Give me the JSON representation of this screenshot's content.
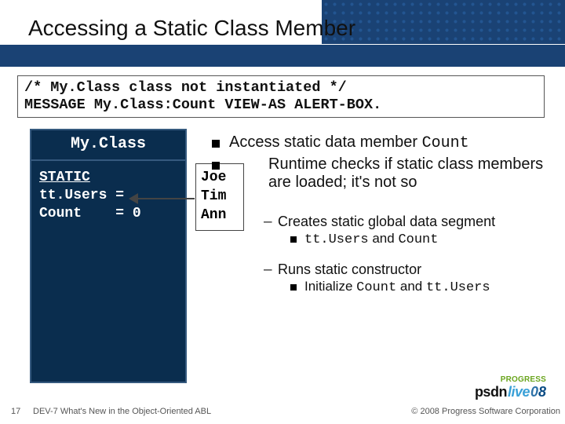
{
  "title": "Accessing a Static Class Member",
  "code_box": {
    "line1": "/* My.Class class not instantiated */",
    "line2": "MESSAGE My.Class:Count VIEW-AS ALERT-BOX."
  },
  "myclass": {
    "header": "My.Class",
    "static_label": "STATIC",
    "ttusers": "tt.Users = ",
    "count": "Count    = 0"
  },
  "names": [
    "Joe",
    "Tim",
    "Ann"
  ],
  "bullets": {
    "b1": "Access static data member ",
    "b1_mono": "Count",
    "b2": "Runtime checks if static class members are loaded; it",
    "b2_apos": "'",
    "b2_rest": "s not so",
    "s1": "Creates static global data segment",
    "s1a_mono1": "tt.Users",
    "s1a_mid": " and ",
    "s1a_mono2": "Count",
    "s2": "Runs static constructor",
    "s2a_pre": "Initialize ",
    "s2a_mono1": "Count",
    "s2a_mid": " and ",
    "s2a_mono2": "tt.Users"
  },
  "logo": {
    "progress": "PROGRESS",
    "psdn": "psdn",
    "live": "live",
    "o8": "08"
  },
  "footer": {
    "num": "17",
    "title": "DEV-7 What's New in the Object-Oriented ABL",
    "copy": "© 2008 Progress Software Corporation"
  }
}
